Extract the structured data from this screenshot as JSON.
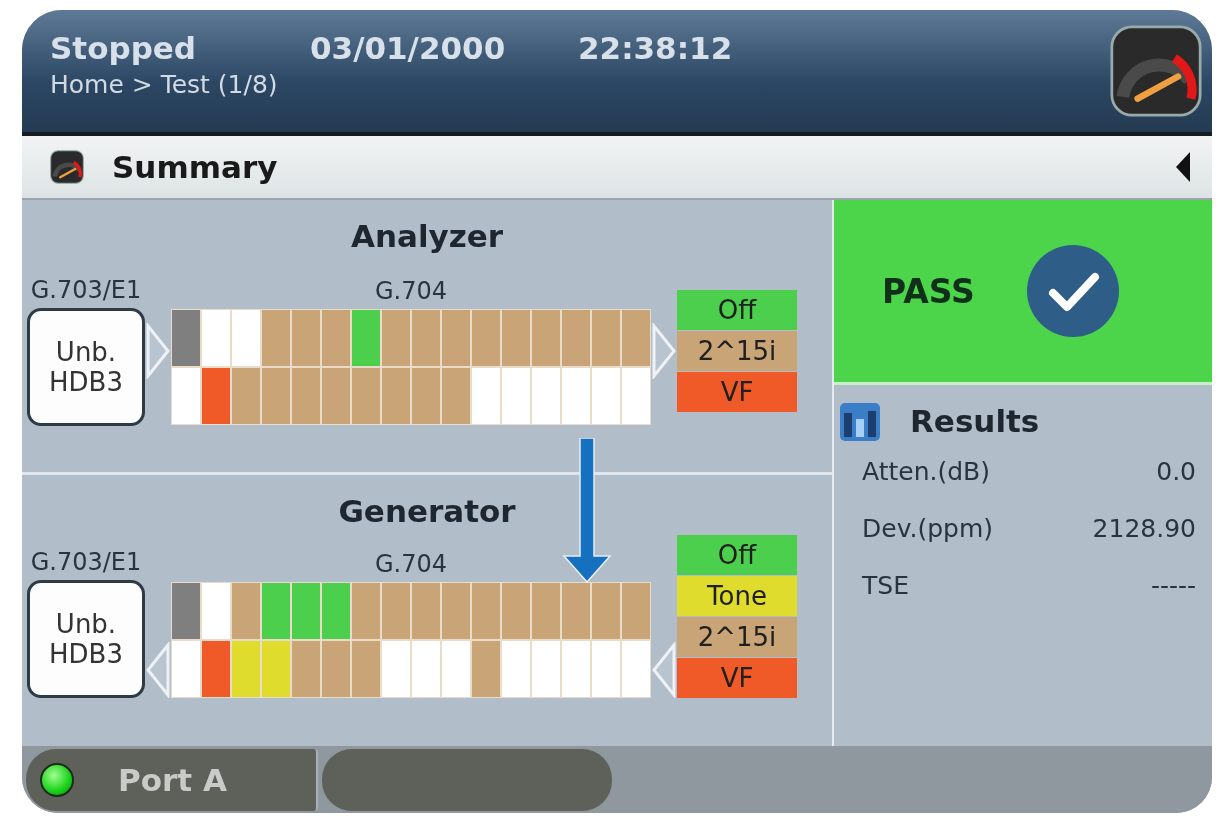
{
  "header": {
    "status": "Stopped",
    "date": "03/01/2000",
    "time": "22:38:12",
    "breadcrumb": "Home > Test (1/8)"
  },
  "section_bar": {
    "title": "Summary"
  },
  "panels": [
    {
      "title": "Analyzer",
      "kind": "analyzer",
      "interface_label": "G.703/E1",
      "interface_lines": [
        "Unb.",
        "HDB3"
      ],
      "framing_label": "G.704",
      "rows": [
        {
          "cells": [
            {
              "color": "#7f7f7f"
            },
            {
              "color": "#ffffff"
            },
            {
              "color": "#ffffff"
            },
            {
              "color": "#c8a476"
            },
            {
              "color": "#c8a476"
            },
            {
              "color": "#c8a476"
            },
            {
              "color": "#4ccf4c"
            },
            {
              "color": "#c8a476"
            },
            {
              "color": "#c8a476"
            },
            {
              "color": "#c8a476"
            },
            {
              "color": "#c8a476"
            },
            {
              "color": "#c8a476"
            },
            {
              "color": "#c8a476"
            },
            {
              "color": "#c8a476"
            },
            {
              "color": "#c8a476"
            },
            {
              "color": "#c8a476"
            }
          ]
        },
        {
          "cells": [
            {
              "color": "#ffffff"
            },
            {
              "color": "#f05a28"
            },
            {
              "color": "#c8a476"
            },
            {
              "color": "#c8a476"
            },
            {
              "color": "#c8a476"
            },
            {
              "color": "#c8a476"
            },
            {
              "color": "#c8a476"
            },
            {
              "color": "#c8a476"
            },
            {
              "color": "#c8a476"
            },
            {
              "color": "#c8a476"
            },
            {
              "color": "#ffffff"
            },
            {
              "color": "#ffffff"
            },
            {
              "color": "#ffffff"
            },
            {
              "color": "#ffffff"
            },
            {
              "color": "#ffffff"
            },
            {
              "color": "#ffffff"
            }
          ]
        }
      ],
      "legend": [
        {
          "label": "Off",
          "color": "#4ccf4c"
        },
        {
          "label": "2^15i",
          "color": "#c8a476"
        },
        {
          "label": "VF",
          "color": "#f05a28"
        }
      ]
    },
    {
      "title": "Generator",
      "kind": "generator",
      "interface_label": "G.703/E1",
      "interface_lines": [
        "Unb.",
        "HDB3"
      ],
      "framing_label": "G.704",
      "rows": [
        {
          "cells": [
            {
              "color": "#7f7f7f"
            },
            {
              "color": "#ffffff"
            },
            {
              "color": "#c8a476"
            },
            {
              "color": "#4ccf4c"
            },
            {
              "color": "#4ccf4c"
            },
            {
              "color": "#4ccf4c"
            },
            {
              "color": "#c8a476"
            },
            {
              "color": "#c8a476"
            },
            {
              "color": "#c8a476"
            },
            {
              "color": "#c8a476"
            },
            {
              "color": "#c8a476"
            },
            {
              "color": "#c8a476"
            },
            {
              "color": "#c8a476"
            },
            {
              "color": "#c8a476"
            },
            {
              "color": "#c8a476"
            },
            {
              "color": "#c8a476"
            }
          ]
        },
        {
          "cells": [
            {
              "color": "#ffffff"
            },
            {
              "color": "#f05a28"
            },
            {
              "color": "#dfdc2e"
            },
            {
              "color": "#dfdc2e"
            },
            {
              "color": "#c8a476"
            },
            {
              "color": "#c8a476"
            },
            {
              "color": "#c8a476"
            },
            {
              "color": "#ffffff"
            },
            {
              "color": "#ffffff"
            },
            {
              "color": "#ffffff"
            },
            {
              "color": "#c8a476"
            },
            {
              "color": "#ffffff"
            },
            {
              "color": "#ffffff"
            },
            {
              "color": "#ffffff"
            },
            {
              "color": "#ffffff"
            },
            {
              "color": "#ffffff"
            }
          ]
        }
      ],
      "legend": [
        {
          "label": "Off",
          "color": "#4ccf4c"
        },
        {
          "label": "Tone",
          "color": "#dfdc2e"
        },
        {
          "label": "2^15i",
          "color": "#c8a476"
        },
        {
          "label": "VF",
          "color": "#f05a28"
        }
      ]
    }
  ],
  "verdict": {
    "label": "PASS",
    "passed": true
  },
  "results": {
    "title": "Results",
    "rows": [
      {
        "label": "Atten.(dB)",
        "value": "0.0"
      },
      {
        "label": "Dev.(ppm)",
        "value": "2128.90"
      },
      {
        "label": "TSE",
        "value": "-----"
      }
    ]
  },
  "ports": [
    {
      "label": "Port A",
      "active": true
    }
  ]
}
